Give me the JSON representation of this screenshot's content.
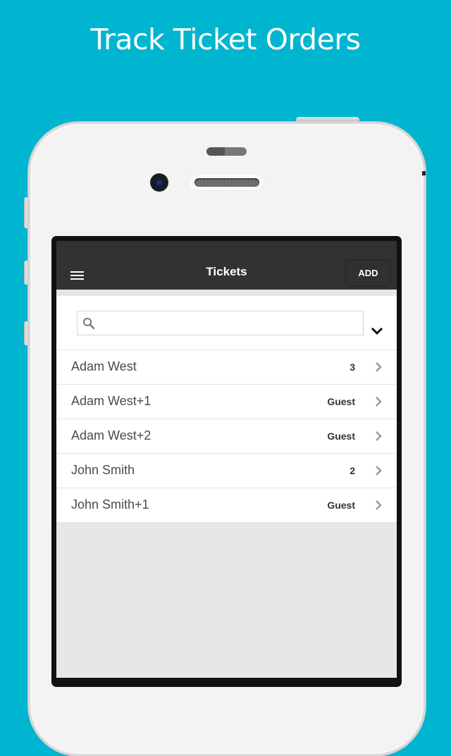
{
  "headline": "Track Ticket Orders",
  "colors": {
    "background": "#00b5cf",
    "navbar": "#323232",
    "list_background": "#e7e7e7"
  },
  "app": {
    "navbar": {
      "menu_icon": "hamburger-menu-icon",
      "title": "Tickets",
      "add_label": "ADD"
    },
    "search": {
      "icon": "search-icon",
      "value": "",
      "placeholder": "",
      "filter_icon": "chevron-down-icon"
    },
    "tickets": [
      {
        "name": "Adam West",
        "count": "3"
      },
      {
        "name": "Adam West+1",
        "count": "Guest"
      },
      {
        "name": "Adam West+2",
        "count": "Guest"
      },
      {
        "name": "John Smith",
        "count": "2"
      },
      {
        "name": "John Smith+1",
        "count": "Guest"
      }
    ]
  }
}
